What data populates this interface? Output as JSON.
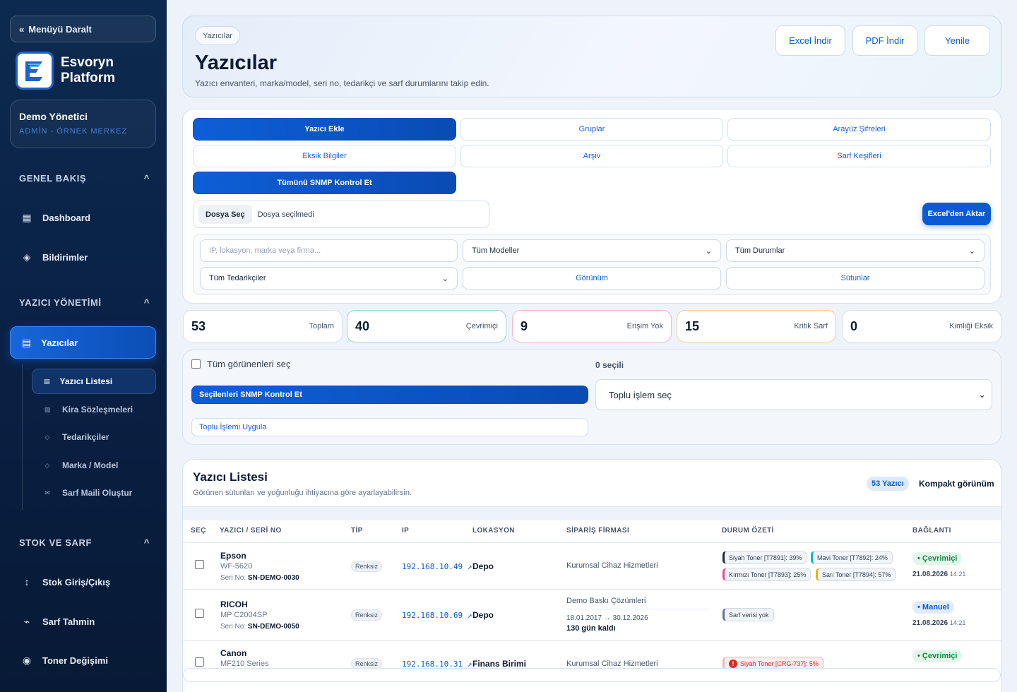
{
  "sidebar": {
    "collapse_label": "Menüyü Daralt",
    "brand_line1": "Esvoryn",
    "brand_line2": "Platform",
    "user_name": "Demo Yönetici",
    "user_role": "ADMİN - ÖRNEK MERKEZ",
    "sec_overview": "GENEL BAKIŞ",
    "dashboard": "Dashboard",
    "notifications": "Bildirimler",
    "sec_printer": "YAZICI YÖNETİMİ",
    "printers": "Yazıcılar",
    "sub_list": "Yazıcı Listesi",
    "sub_leases": "Kira Sözleşmeleri",
    "sub_suppliers": "Tedarikçiler",
    "sub_brand": "Marka / Model",
    "sub_mail": "Sarf Maili Oluştur",
    "sec_stock": "STOK VE SARF",
    "stock_io": "Stok Giriş/Çıkış",
    "forecast": "Sarf Tahmin",
    "toner": "Toner Değişimi",
    "chevron": "^"
  },
  "header": {
    "crumb": "Yazıcılar",
    "title": "Yazıcılar",
    "subtitle": "Yazıcı envanteri, marka/model, seri no, tedarikçi ve sarf durumlarını takip edin.",
    "excel": "Excel İndir",
    "pdf": "PDF İndir",
    "refresh": "Yenile"
  },
  "tools": {
    "add": "Yazıcı Ekle",
    "groups": "Gruplar",
    "passwords": "Arayüz Şifreleri",
    "missing": "Eksik Bilgiler",
    "archive": "Arşiv",
    "discover": "Sarf Keşifleri",
    "snmp_all": "Tümünü SNMP Kontrol Et",
    "file_btn": "Dosya Seç",
    "file_none": "Dosya seçilmedi",
    "import": "Excel'den Aktar"
  },
  "filters": {
    "search_ph": "IP, lokasyon, marka veya firma...",
    "models": "Tüm Modeller",
    "statuses": "Tüm Durumlar",
    "suppliers": "Tüm Tedarikçiler",
    "view": "Görünüm",
    "columns": "Sütunlar"
  },
  "stats": [
    {
      "value": "53",
      "label": "Toplam"
    },
    {
      "value": "40",
      "label": "Çevrimiçi"
    },
    {
      "value": "9",
      "label": "Erişim Yok"
    },
    {
      "value": "15",
      "label": "Kritik Sarf"
    },
    {
      "value": "0",
      "label": "Kimliği Eksik"
    }
  ],
  "bulk": {
    "select_all": "Tüm görünenleri seç",
    "selected": "0 seçili",
    "snmp_selected": "Seçilenleri SNMP Kontrol Et",
    "action_select": "Toplu işlem seç",
    "apply": "Toplu İşlemi Uygula"
  },
  "list": {
    "title": "Yazıcı Listesi",
    "subtitle": "Görünen sütunları ve yoğunluğu ihtiyacına göre ayarlayabilirsin.",
    "count": "53 Yazıcı",
    "compact": "Kompakt görünüm",
    "columns": [
      "SEÇ",
      "YAZICI / SERİ NO",
      "TİP",
      "IP",
      "LOKASYON",
      "SİPARİŞ FİRMASI",
      "DURUM ÖZETİ",
      "BAĞLANTI"
    ],
    "serial_label": "Seri No:",
    "rows": [
      {
        "brand": "Epson",
        "model": "WF-5620",
        "serial": "SN-DEMO-0030",
        "type": "Renksiz",
        "ip": "192.168.10.49 ↗",
        "location": "Depo",
        "firm": "Kurumsal Cihaz Hizmetleri",
        "supplies": [
          "Siyah Toner [T7891]: 39%",
          "Mavi Toner [T7892]: 24%",
          "Kırmızı Toner [T7893]: 25%",
          "Sarı Toner [T7894]: 57%"
        ],
        "status": "• Çevrimiçi",
        "date": "21.08.2026",
        "time": "14:21"
      },
      {
        "brand": "RICOH",
        "model": "MP C2004SP",
        "serial": "SN-DEMO-0050",
        "type": "Renksiz",
        "ip": "192.168.10.69 ↗",
        "location": "Depo",
        "firm": "Demo Baskı Çözümleri",
        "contract": "18.01.2017 → 30.12.2026",
        "remaining": "130 gün kaldı",
        "supplies": [
          "Sarf verisi yok"
        ],
        "status": "• Manuel",
        "date": "21.08.2026",
        "time": "14:21"
      },
      {
        "brand": "Canon",
        "model": "MF210 Series",
        "type": "Renksiz",
        "ip": "192.168.10.31 ↗",
        "location": "Finans Birimi",
        "firm": "Kurumsal Cihaz Hizmetleri",
        "supplies": [
          "Siyah Toner [CRG-737]: 5%"
        ],
        "status": "• Çevrimiçi"
      }
    ]
  },
  "colors": {
    "accent": "#0b5ad4",
    "sidebar": "#0a2246",
    "online": "#16883b",
    "critical": "#dc2626"
  }
}
